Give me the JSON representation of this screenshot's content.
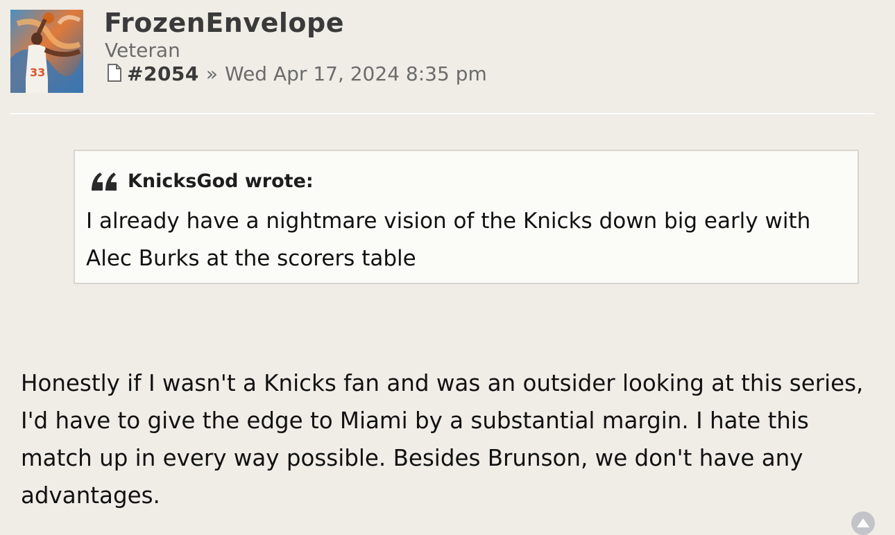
{
  "post": {
    "author": "FrozenEnvelope",
    "rank": "Veteran",
    "post_number": "#2054",
    "separator": "»",
    "datetime": "Wed Apr 17, 2024 8:35 pm",
    "avatar_icon": "basketball-player-avatar",
    "post_icon": "document-icon"
  },
  "quote": {
    "author_line": "KnicksGod wrote:",
    "icon": "quote-marks-icon",
    "text": "I already have a nightmare vision of the Knicks down big early with Alec Burks at the scorers table"
  },
  "body": {
    "text": "Honestly if I wasn't a Knicks fan and was an outsider looking at this series, I'd have to give the edge to Miami by a substantial margin. I hate this match up in every way possible. Besides Brunson, we don't have any advantages."
  },
  "nav": {
    "top_icon": "scroll-to-top-icon"
  },
  "colors": {
    "page_bg": "#efede6",
    "quote_bg": "#fbfbf8",
    "username": "#3a3a3a",
    "meta": "#6b6b6b"
  }
}
